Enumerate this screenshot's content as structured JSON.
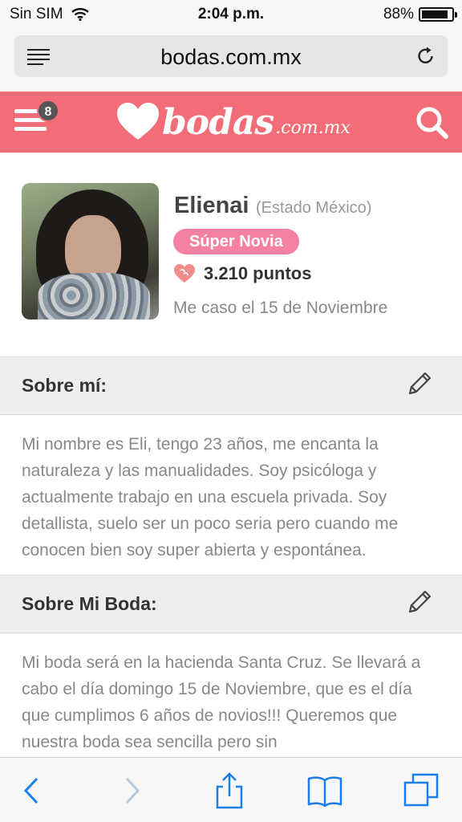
{
  "status_bar": {
    "carrier": "Sin SIM",
    "time": "2:04 p.m.",
    "battery": "88%",
    "battery_level": 0.88
  },
  "browser": {
    "url": "bodas.com.mx"
  },
  "site": {
    "brand_color": "#f26d78",
    "menu_badge": "8",
    "logo_text": "bodas",
    "logo_suffix": ".com.mx"
  },
  "profile": {
    "name": "Elienai",
    "location": "(Estado México)",
    "tag": "Súper Novia",
    "points": "3.210 puntos",
    "wedding_date": "Me caso el 15 de Noviembre",
    "tag_color": "#f481a3"
  },
  "sections": {
    "about_me": {
      "title": "Sobre mí:",
      "text": "Mi nombre es Eli, tengo 23 años, me encanta la naturaleza y las manualidades. Soy psicóloga y actualmente trabajo en una escuela privada. Soy detallista, suelo ser un poco seria pero cuando me conocen bien soy super abierta y espontánea."
    },
    "about_wedding": {
      "title": "Sobre Mi Boda:",
      "text": "Mi boda será en la hacienda Santa Cruz. Se llevará a cabo el día domingo 15 de Noviembre, que es el día que cumplimos 6 años de novios!!! Queremos que nuestra boda sea sencilla pero sin"
    }
  },
  "toolbar": {
    "icons": [
      "back-icon",
      "forward-icon",
      "share-icon",
      "bookmarks-icon",
      "tabs-icon"
    ],
    "accent": "#1a7fe8"
  }
}
